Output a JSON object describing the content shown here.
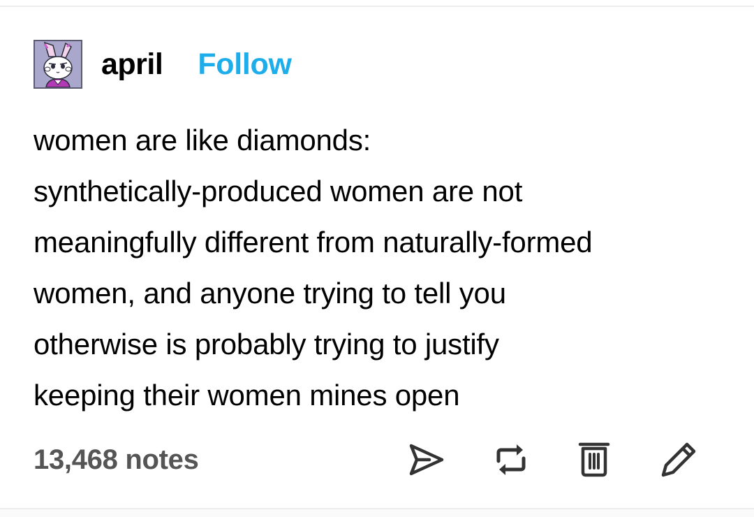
{
  "post": {
    "author": "april",
    "follow_label": "Follow",
    "body_lines": [
      "women are like diamonds:",
      "synthetically-produced women are not",
      "meaningfully different from naturally-formed",
      "women, and anyone trying to tell you",
      "otherwise is probably trying to justify",
      "keeping their women mines open"
    ],
    "notes_count": "13,468 notes"
  },
  "icons": {
    "avatar": "bunny-avatar",
    "share": "send-icon",
    "reblog": "reblog-icon",
    "delete": "trash-icon",
    "edit": "pencil-icon"
  },
  "colors": {
    "follow": "#1dadea",
    "notes": "#555555",
    "icons": "#333333"
  }
}
